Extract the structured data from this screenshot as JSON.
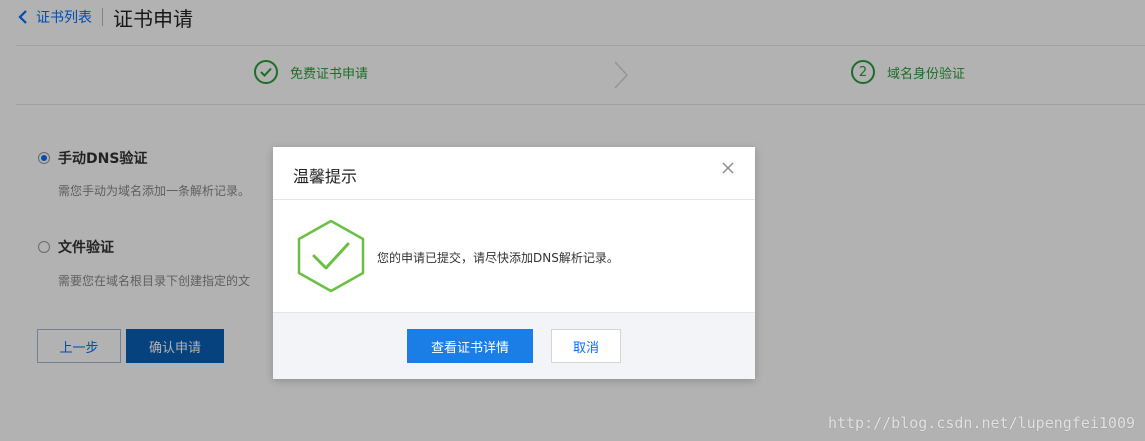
{
  "header": {
    "back_label": "证书列表",
    "title": "证书申请"
  },
  "steps": [
    {
      "number": "",
      "label": "免费证书申请",
      "state": "done"
    },
    {
      "number": "2",
      "label": "域名身份验证",
      "state": "current"
    }
  ],
  "options": [
    {
      "label": "手动DNS验证",
      "description": "需您手动为域名添加一条解析记录。",
      "selected": true
    },
    {
      "label": "文件验证",
      "description": "需要您在域名根目录下创建指定的文",
      "selected": false
    }
  ],
  "actions": {
    "prev_label": "上一步",
    "confirm_label": "确认申请"
  },
  "modal": {
    "title": "温馨提示",
    "message": "您的申请已提交，请尽快添加DNS解析记录。",
    "primary_label": "查看证书详情",
    "cancel_label": "取消",
    "icon": "check-hexagon-icon"
  },
  "watermark": "http://blog.csdn.net/lupengfei1009",
  "colors": {
    "accent": "#006eff",
    "success": "#2a9d3a",
    "primary_button": "#1a7ee6"
  }
}
